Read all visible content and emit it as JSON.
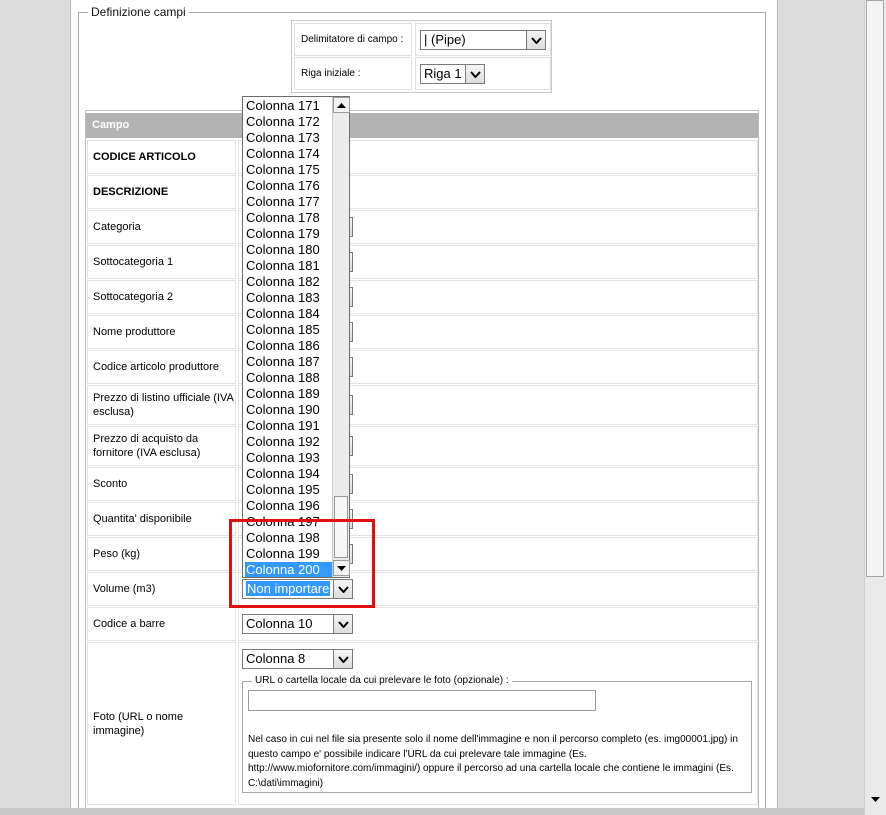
{
  "fieldset": {
    "legend": "Definizione campi"
  },
  "settings": {
    "delimiter_label": "Delimitatore di campo :",
    "delimiter_value": "| (Pipe)",
    "start_row_label": "Riga iniziale :",
    "start_row_value": "Riga 1"
  },
  "grid": {
    "header_label": "Campo",
    "rows": [
      {
        "label": "CODICE ARTICOLO"
      },
      {
        "label": "DESCRIZIONE"
      },
      {
        "label": "Categoria"
      },
      {
        "label": "Sottocategoria 1"
      },
      {
        "label": "Sottocategoria 2"
      },
      {
        "label": "Nome produttore"
      },
      {
        "label": "Codice articolo produttore"
      },
      {
        "label": "Prezzo di listino ufficiale (IVA esclusa)"
      },
      {
        "label": "Prezzo di acquisto da fornitore (IVA esclusa)"
      },
      {
        "label": "Sconto"
      },
      {
        "label": "Quantita' disponibile"
      },
      {
        "label": "Peso (kg)"
      },
      {
        "label": "Volume (m3)",
        "value": "Non importare"
      },
      {
        "label": "Codice a barre",
        "value": "Colonna 10"
      },
      {
        "label": "Foto (URL o nome immagine)",
        "value": "Colonna 8"
      }
    ]
  },
  "foto": {
    "legend": "URL o cartella locale da cui prelevare le foto (opzionale) :",
    "input_value": "",
    "note": "Nel caso in cui nel file sia presente solo il nome dell'immagine e non il percorso completo (es. img00001.jpg) in questo campo e' possibile indicare l'URL da cui prelevare tale immagine (Es. http://www.miofornitore.com/immagini/) oppure il percorso ad una cartella locale che contiene le immagini (Es. C:\\dati\\immagini)"
  },
  "dropdown": {
    "options": [
      "Colonna 171",
      "Colonna 172",
      "Colonna 173",
      "Colonna 174",
      "Colonna 175",
      "Colonna 176",
      "Colonna 177",
      "Colonna 178",
      "Colonna 179",
      "Colonna 180",
      "Colonna 181",
      "Colonna 182",
      "Colonna 183",
      "Colonna 184",
      "Colonna 185",
      "Colonna 186",
      "Colonna 187",
      "Colonna 188",
      "Colonna 189",
      "Colonna 190",
      "Colonna 191",
      "Colonna 192",
      "Colonna 193",
      "Colonna 194",
      "Colonna 195",
      "Colonna 196",
      "Colonna 197",
      "Colonna 198",
      "Colonna 199",
      "Colonna 200"
    ],
    "highlighted": "Colonna 200"
  },
  "colors": {
    "selection": "#3399ff",
    "highlight_box": "#e01010",
    "header_bg": "#b3b3b3"
  }
}
